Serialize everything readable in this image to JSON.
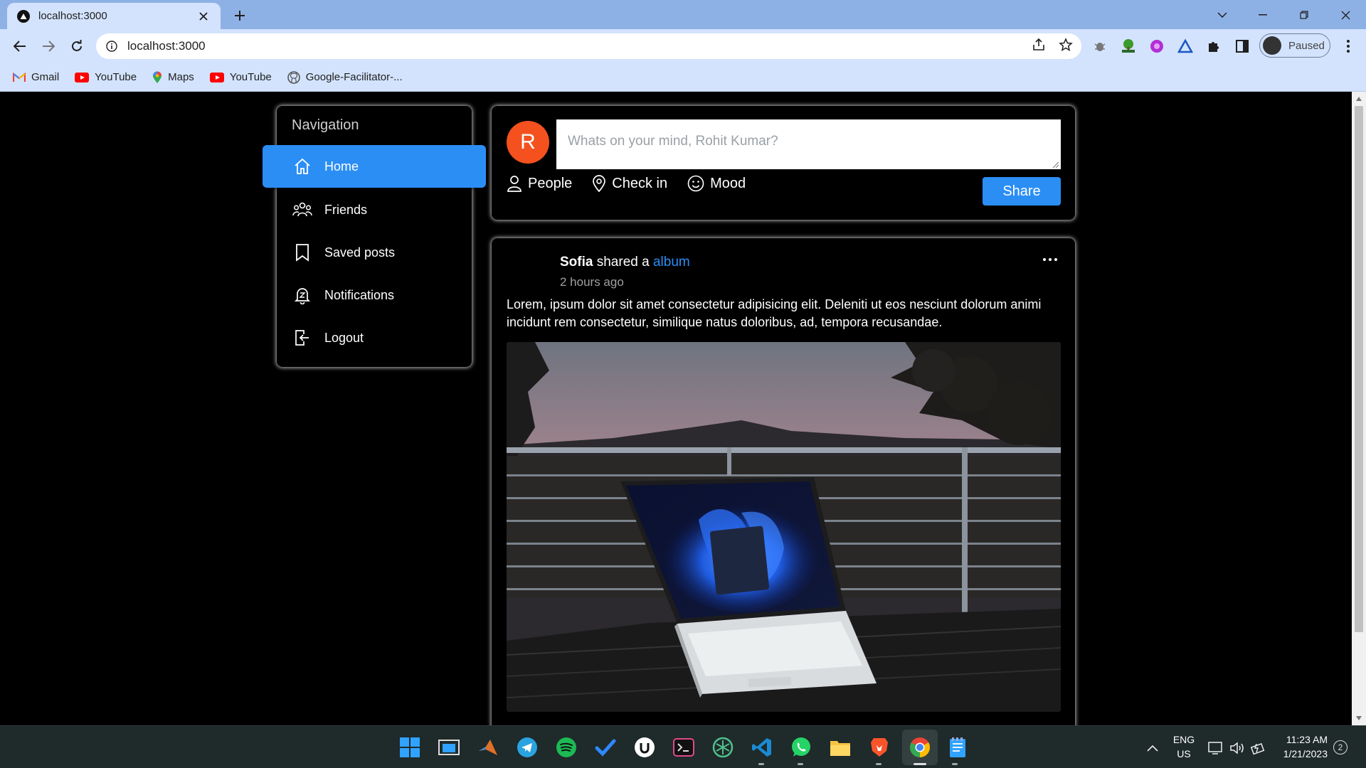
{
  "browser": {
    "tab_title": "localhost:3000",
    "url": "localhost:3000",
    "profile_label": "Paused",
    "bookmarks": [
      {
        "label": "Gmail",
        "icon": "gmail-icon"
      },
      {
        "label": "YouTube",
        "icon": "youtube-icon"
      },
      {
        "label": "Maps",
        "icon": "maps-icon"
      },
      {
        "label": "YouTube",
        "icon": "youtube-icon"
      },
      {
        "label": "Google-Facilitator-...",
        "icon": "github-icon"
      }
    ]
  },
  "sidebar": {
    "title": "Navigation",
    "items": [
      {
        "label": "Home",
        "icon": "home-icon",
        "active": true
      },
      {
        "label": "Friends",
        "icon": "friends-icon"
      },
      {
        "label": "Saved posts",
        "icon": "bookmark-icon"
      },
      {
        "label": "Notifications",
        "icon": "bell-icon"
      },
      {
        "label": "Logout",
        "icon": "logout-icon"
      }
    ]
  },
  "composer": {
    "avatar_letter": "R",
    "placeholder": "Whats on your mind, Rohit Kumar?",
    "actions": [
      {
        "label": "People",
        "icon": "person-icon"
      },
      {
        "label": "Check in",
        "icon": "location-pin-icon"
      },
      {
        "label": "Mood",
        "icon": "smiley-icon"
      }
    ],
    "share_label": "Share"
  },
  "post": {
    "author": "Sofia",
    "action_text": "shared a",
    "link_text": "album",
    "time": "2 hours ago",
    "body": "Lorem, ipsum dolor sit amet consectetur adipisicing elit. Deleniti ut eos nesciunt dolorum animi incidunt rem consectetur, similique natus doloribus, ad, tempora recusandae."
  },
  "taskbar": {
    "language": "ENG",
    "region": "US",
    "time": "11:23 AM",
    "date": "1/21/2023",
    "notification_count": "2"
  },
  "colors": {
    "accent": "#2b8ef5",
    "avatar": "#f4511e",
    "page_bg": "#000000",
    "chrome_tabbar": "#8eb1e5",
    "chrome_toolbar": "#d3e3fd"
  }
}
